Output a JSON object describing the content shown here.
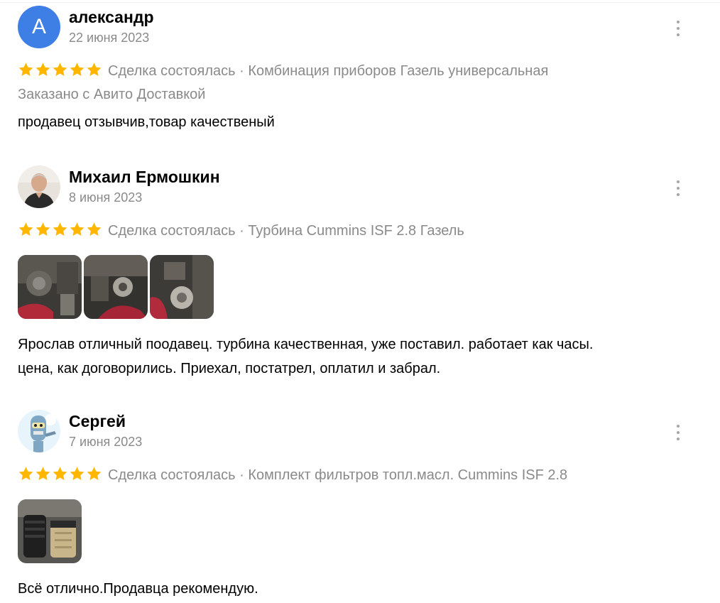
{
  "colors": {
    "star": "#ffb600",
    "muted_text": "#8a8a8a",
    "avatar_letter_bg": "#3e7fe6",
    "menu_dots": "#a5a5a5"
  },
  "reviews": [
    {
      "avatar_letter": "А",
      "name": "александр",
      "date": "22 июня 2023",
      "rating": 5,
      "meta": "Сделка состоялась · Комбинация приборов Газель универсальная",
      "delivery": "Заказано с Авито Доставкой",
      "text": [
        "продавец отзывчив,товар качественый"
      ],
      "menu_icon": "more-vertical-icon"
    },
    {
      "avatar_letter": "",
      "name": "Михаил Ермошкин",
      "date": "8 июня 2023",
      "rating": 5,
      "meta": "Сделка состоялась · Турбина Cummins ISF 2.8 Газель",
      "delivery": "",
      "photo_count": 3,
      "text": [
        "Ярослав отличный поодавец. турбина качественная, уже поставил. работает как часы.",
        "цена, как договорились. Приехал, постатрел, оплатил и забрал."
      ],
      "menu_icon": "more-vertical-icon"
    },
    {
      "avatar_letter": "",
      "name": "Сергей",
      "date": "7 июня 2023",
      "rating": 5,
      "meta": "Сделка состоялась · Комплект фильтров топл.масл. Cummins ISF 2.8",
      "delivery": "",
      "photo_count": 1,
      "text": [
        "Всё отлично.Продавца рекомендую."
      ],
      "menu_icon": "more-vertical-icon"
    }
  ]
}
